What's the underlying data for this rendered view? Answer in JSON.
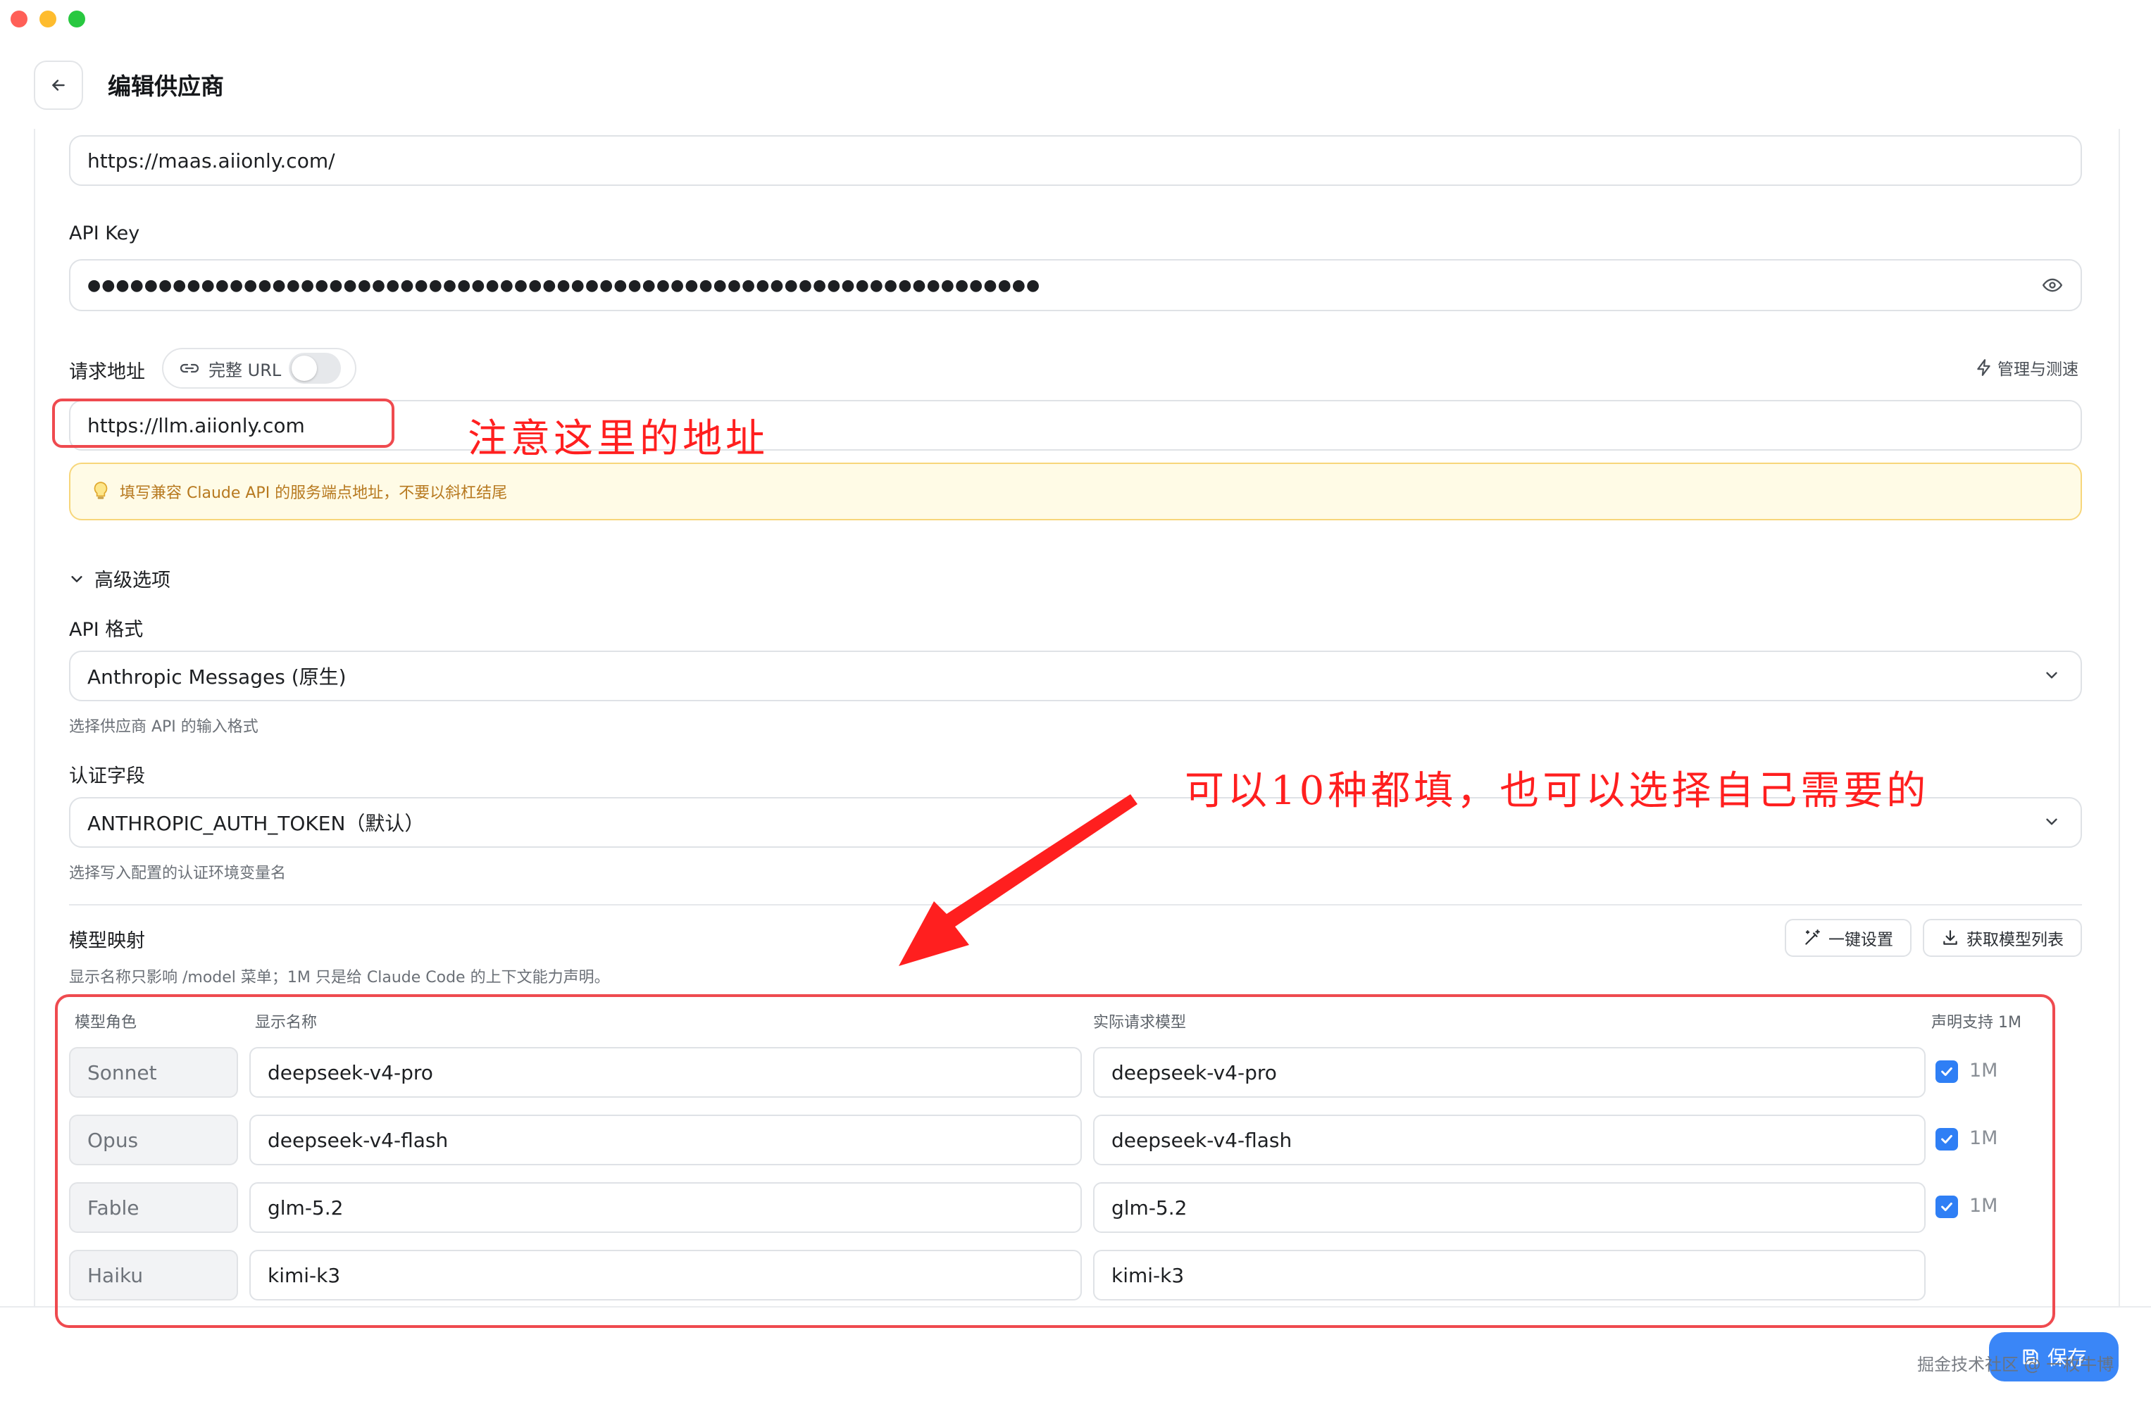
{
  "window": {
    "colors": {
      "close": "#ff5f57",
      "minimize": "#febc2e",
      "zoom": "#28c840"
    }
  },
  "header": {
    "title": "编辑供应商"
  },
  "website": {
    "value": "https://maas.aiionly.com/"
  },
  "api_key": {
    "label": "API Key",
    "value": "●●●●●●●●●●●●●●●●●●●●●●●●●●●●●●●●●●●●●●●●●●●●●●●●●●●●●●●●●●●●●●●●●●●"
  },
  "endpoint": {
    "label": "请求地址",
    "full_url_label": "完整 URL",
    "full_url_enabled": false,
    "manage_label": "管理与测速",
    "value": "https://llm.aiionly.com",
    "notice": "填写兼容 Claude API 的服务端点地址，不要以斜杠结尾"
  },
  "advanced": {
    "toggle_label": "高级选项",
    "api_format": {
      "label": "API 格式",
      "selected": "Anthropic Messages (原生)",
      "hint": "选择供应商 API 的输入格式"
    },
    "auth_field": {
      "label": "认证字段",
      "selected": "ANTHROPIC_AUTH_TOKEN（默认）",
      "hint": "选择写入配置的认证环境变量名"
    }
  },
  "model_mapping": {
    "title": "模型映射",
    "hint": "显示名称只影响 /model 菜单；1M 只是给 Claude Code 的上下文能力声明。",
    "one_click_label": "一键设置",
    "fetch_label": "获取模型列表",
    "columns": [
      "模型角色",
      "显示名称",
      "实际请求模型",
      "声明支持 1M"
    ],
    "rows": [
      {
        "role": "Sonnet",
        "display": "deepseek-v4-pro",
        "actual": "deepseek-v4-pro",
        "supports_1m": true,
        "badge": "1M"
      },
      {
        "role": "Opus",
        "display": "deepseek-v4-flash",
        "actual": "deepseek-v4-flash",
        "supports_1m": true,
        "badge": "1M"
      },
      {
        "role": "Fable",
        "display": "glm-5.2",
        "actual": "glm-5.2",
        "supports_1m": true,
        "badge": "1M"
      },
      {
        "role": "Haiku",
        "display": "kimi-k3",
        "actual": "kimi-k3",
        "supports_1m": false,
        "badge": ""
      }
    ]
  },
  "annotations": {
    "address_note": "注意这里的地址",
    "mapping_note": "可以10种都填，也可以选择自己需要的",
    "color": "#ff1f1f"
  },
  "footer": {
    "save_label": "保存",
    "watermark": "掘金技术社区 @ 一枚牛博"
  }
}
